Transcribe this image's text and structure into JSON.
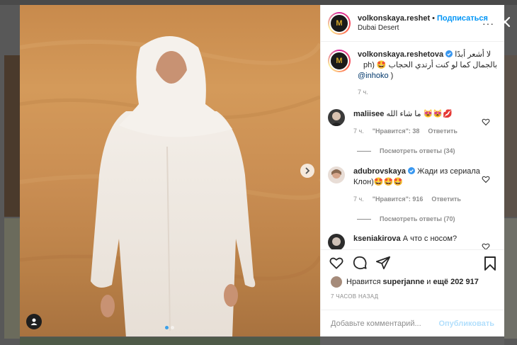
{
  "post": {
    "username": "volkonskaya.reshet",
    "follow_separator": "•",
    "follow_label": "Подписаться",
    "location": "Dubai Desert",
    "more_label": "···",
    "avatar_letters": "M"
  },
  "caption": {
    "username": "volkonskaya.reshetova",
    "text_line1": "لا أشعر أبدًا",
    "text_line2": "بالجمال كما لو كنت أرتدي الحجاب 🤩 (ph",
    "mention": "@inhoko",
    "closing": " )",
    "time": "7 ч."
  },
  "comments": [
    {
      "username": "maliisee",
      "text": "ما شاء الله 😻😻💋",
      "time": "7 ч.",
      "likes": "\"Нравится\": 38",
      "reply": "Ответить",
      "replies": "Посмотреть ответы (34)"
    },
    {
      "username": "adubrovskaya",
      "text": "Жади из сериала Клон)🤩🤩🤩",
      "time": "7 ч.",
      "likes": "\"Нравится\": 916",
      "reply": "Ответить",
      "replies": "Посмотреть ответы (70)"
    },
    {
      "username": "kseniakirova",
      "text": "А что с носом?"
    }
  ],
  "likes": {
    "prefix": "Нравится ",
    "user": "superjanne",
    "middle": " и ",
    "count": "ещё 202 917"
  },
  "posted_ago": "7 ЧАСОВ НАЗАД",
  "add_comment": {
    "placeholder": "Добавьте комментарий...",
    "publish_label": "Опубликовать"
  },
  "colors": {
    "accent": "#0095f6",
    "verified": "#3897f0",
    "publish_disabled": "#b2dffc"
  }
}
